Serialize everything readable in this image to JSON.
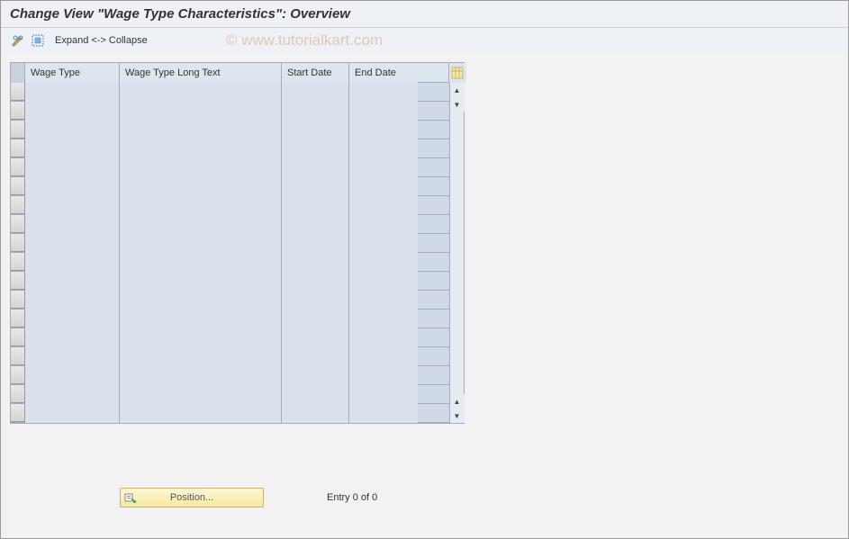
{
  "title": "Change View \"Wage Type Characteristics\": Overview",
  "toolbar": {
    "expand_collapse": "Expand <-> Collapse"
  },
  "watermark": "© www.tutorialkart.com",
  "table": {
    "columns": {
      "wage_type": "Wage Type",
      "long_text": "Wage Type Long Text",
      "start_date": "Start Date",
      "end_date": "End Date"
    },
    "row_count": 18
  },
  "footer": {
    "position_label": "Position...",
    "entry_text": "Entry 0 of 0"
  },
  "icons": {
    "edit": "pencil-glasses-icon",
    "select_all": "bounding-box-icon",
    "table_settings": "table-settings-icon",
    "position": "position-locator-icon"
  }
}
